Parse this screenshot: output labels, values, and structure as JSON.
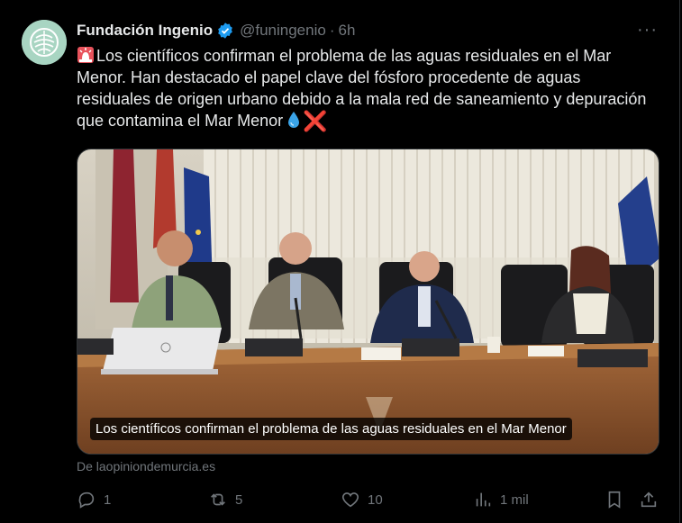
{
  "author": {
    "name": "Fundación Ingenio",
    "handle": "@funingenio",
    "time": "6h",
    "separator": "·"
  },
  "tweet": {
    "text": "Los científicos confirman el problema de las aguas residuales en el Mar Menor. Han destacado el papel clave del fósforo procedente de aguas residuales de origen urbano debido a la mala red de saneamiento y depuración que contamina el Mar Menor",
    "emoji_end": "❌"
  },
  "media": {
    "caption": "Los científicos confirman el problema de las aguas residuales en el Mar Menor"
  },
  "source": {
    "text": "De laopiniondemurcia.es"
  },
  "actions": {
    "replies": "1",
    "reposts": "5",
    "likes": "10",
    "views": "1 mil"
  },
  "colors": {
    "background": "#000000",
    "text": "#e7e9ea",
    "muted": "#71767b",
    "verified": "#1d9bf0"
  },
  "icons": [
    "more-icon",
    "verified-icon",
    "siren-emoji",
    "droplet-emoji",
    "cross-mark-emoji",
    "reply-icon",
    "repost-icon",
    "like-icon",
    "views-icon",
    "bookmark-icon",
    "share-icon"
  ]
}
